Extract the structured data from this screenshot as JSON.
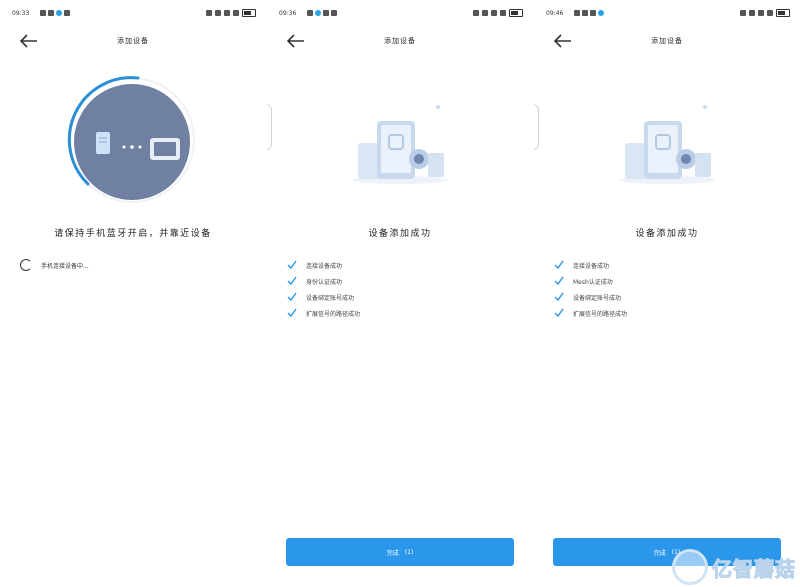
{
  "colors": {
    "accent": "#2a97ea",
    "spinner_ring": "#2a8fd6",
    "device_circle": "#6f80a3"
  },
  "panels": [
    {
      "time": "09:33",
      "title": "添加设备",
      "caption": "请保持手机蓝牙开启，并靠近设备",
      "progress_text": "手机连接设备中..."
    },
    {
      "time": "09:36",
      "title": "添加设备",
      "caption": "设备添加成功",
      "steps": [
        "连接设备成功",
        "身份认证成功",
        "设备绑定账号成功",
        "扩展信号的路径成功"
      ],
      "done_label": "完成",
      "done_count": "(1)"
    },
    {
      "time": "09:46",
      "title": "添加设备",
      "caption": "设备添加成功",
      "steps": [
        "连接设备成功",
        "Mesh认证成功",
        "设备绑定账号成功",
        "扩展信号的路径成功"
      ],
      "done_label": "完成",
      "done_count": "(1)"
    }
  ],
  "watermark": {
    "text": "亿智蘑菇"
  }
}
